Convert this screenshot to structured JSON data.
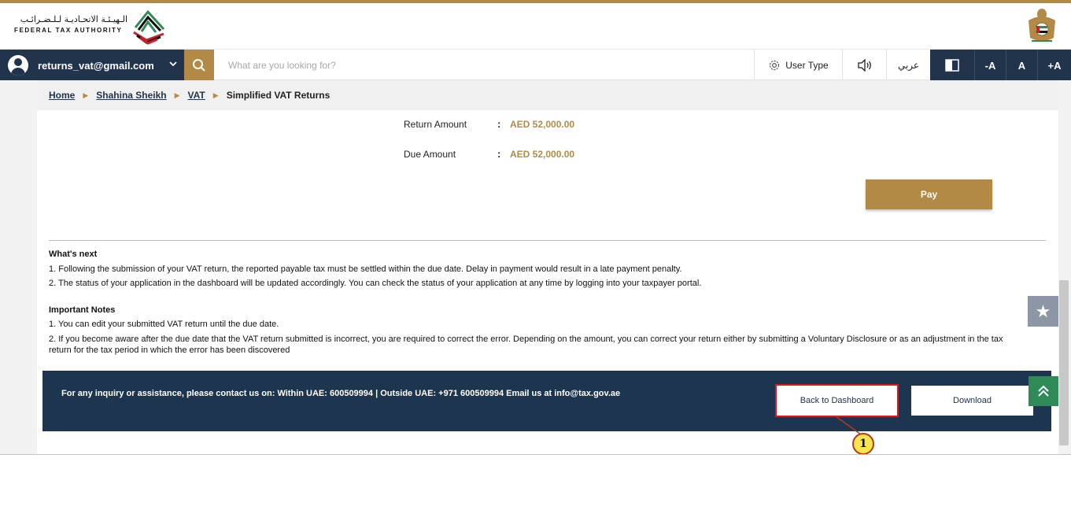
{
  "header": {
    "logo_arabic": "الـهيـئـة الاتحـاديـة لـلـضـرائـب",
    "logo_english": "FEDERAL TAX AUTHORITY",
    "brand_color": "#b28a45",
    "navy_color": "#21344c"
  },
  "navbar": {
    "user_email": "returns_vat@gmail.com",
    "search_placeholder": "What are you looking for?",
    "user_type_label": "User Type",
    "language_label": "عربي",
    "font_decrease": "-A",
    "font_normal": "A",
    "font_increase": "+A"
  },
  "breadcrumb": {
    "items": [
      "Home",
      "Shahina Sheikh",
      "VAT"
    ],
    "current": "Simplified VAT Returns"
  },
  "summary": {
    "return_amount_label": "Return Amount",
    "return_amount_value": "AED 52,000.00",
    "due_amount_label": "Due Amount",
    "due_amount_value": "AED 52,000.00",
    "separator": ":"
  },
  "pay_button_label": "Pay",
  "whats_next": {
    "title": "What's next",
    "lines": [
      "1. Following the submission of your VAT return, the reported payable tax must be settled within the due date. Delay in payment would result in a late payment penalty.",
      "2. The status of your application in the dashboard will be updated accordingly. You can check the status of your application at any time by logging into your taxpayer portal."
    ]
  },
  "important_notes": {
    "title": "Important Notes",
    "lines": [
      "1. You can edit your submitted VAT return until the due date.",
      "2. If you become aware after the due date that the VAT return submitted is incorrect, you are required to correct the error. Depending on the amount, you can correct your return either by submitting a Voluntary Disclosure or as an adjustment in the tax return for the tax period in which the error has been discovered"
    ]
  },
  "footer": {
    "contact_text": "For any inquiry or assistance, please contact us on: Within UAE: 600509994 | Outside UAE: +971 600509994 Email us at info@tax.gov.ae",
    "back_to_dashboard_label": "Back to Dashboard",
    "download_label": "Download"
  },
  "annotation": {
    "number": "1"
  }
}
